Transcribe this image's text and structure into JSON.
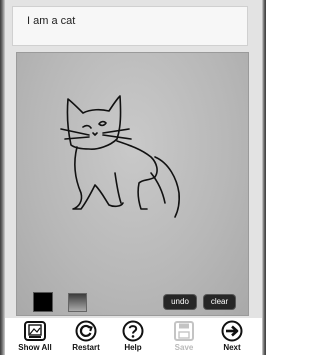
{
  "prompt": {
    "text": "I am a cat"
  },
  "canvas": {
    "color_swatches": [
      "black",
      "gray-gradient"
    ],
    "undo_label": "undo",
    "clear_label": "clear"
  },
  "toolbar": {
    "items": [
      {
        "label": "Show All",
        "icon": "gallery-icon",
        "enabled": true
      },
      {
        "label": "Restart",
        "icon": "restart-icon",
        "enabled": true
      },
      {
        "label": "Help",
        "icon": "help-icon",
        "enabled": true
      },
      {
        "label": "Save",
        "icon": "save-icon",
        "enabled": false
      },
      {
        "label": "Next",
        "icon": "next-arrow-icon",
        "enabled": true
      }
    ]
  },
  "colors": {
    "frame": "#e3e3e3",
    "canvas": "#b9b9b9",
    "stroke": "#111111"
  }
}
